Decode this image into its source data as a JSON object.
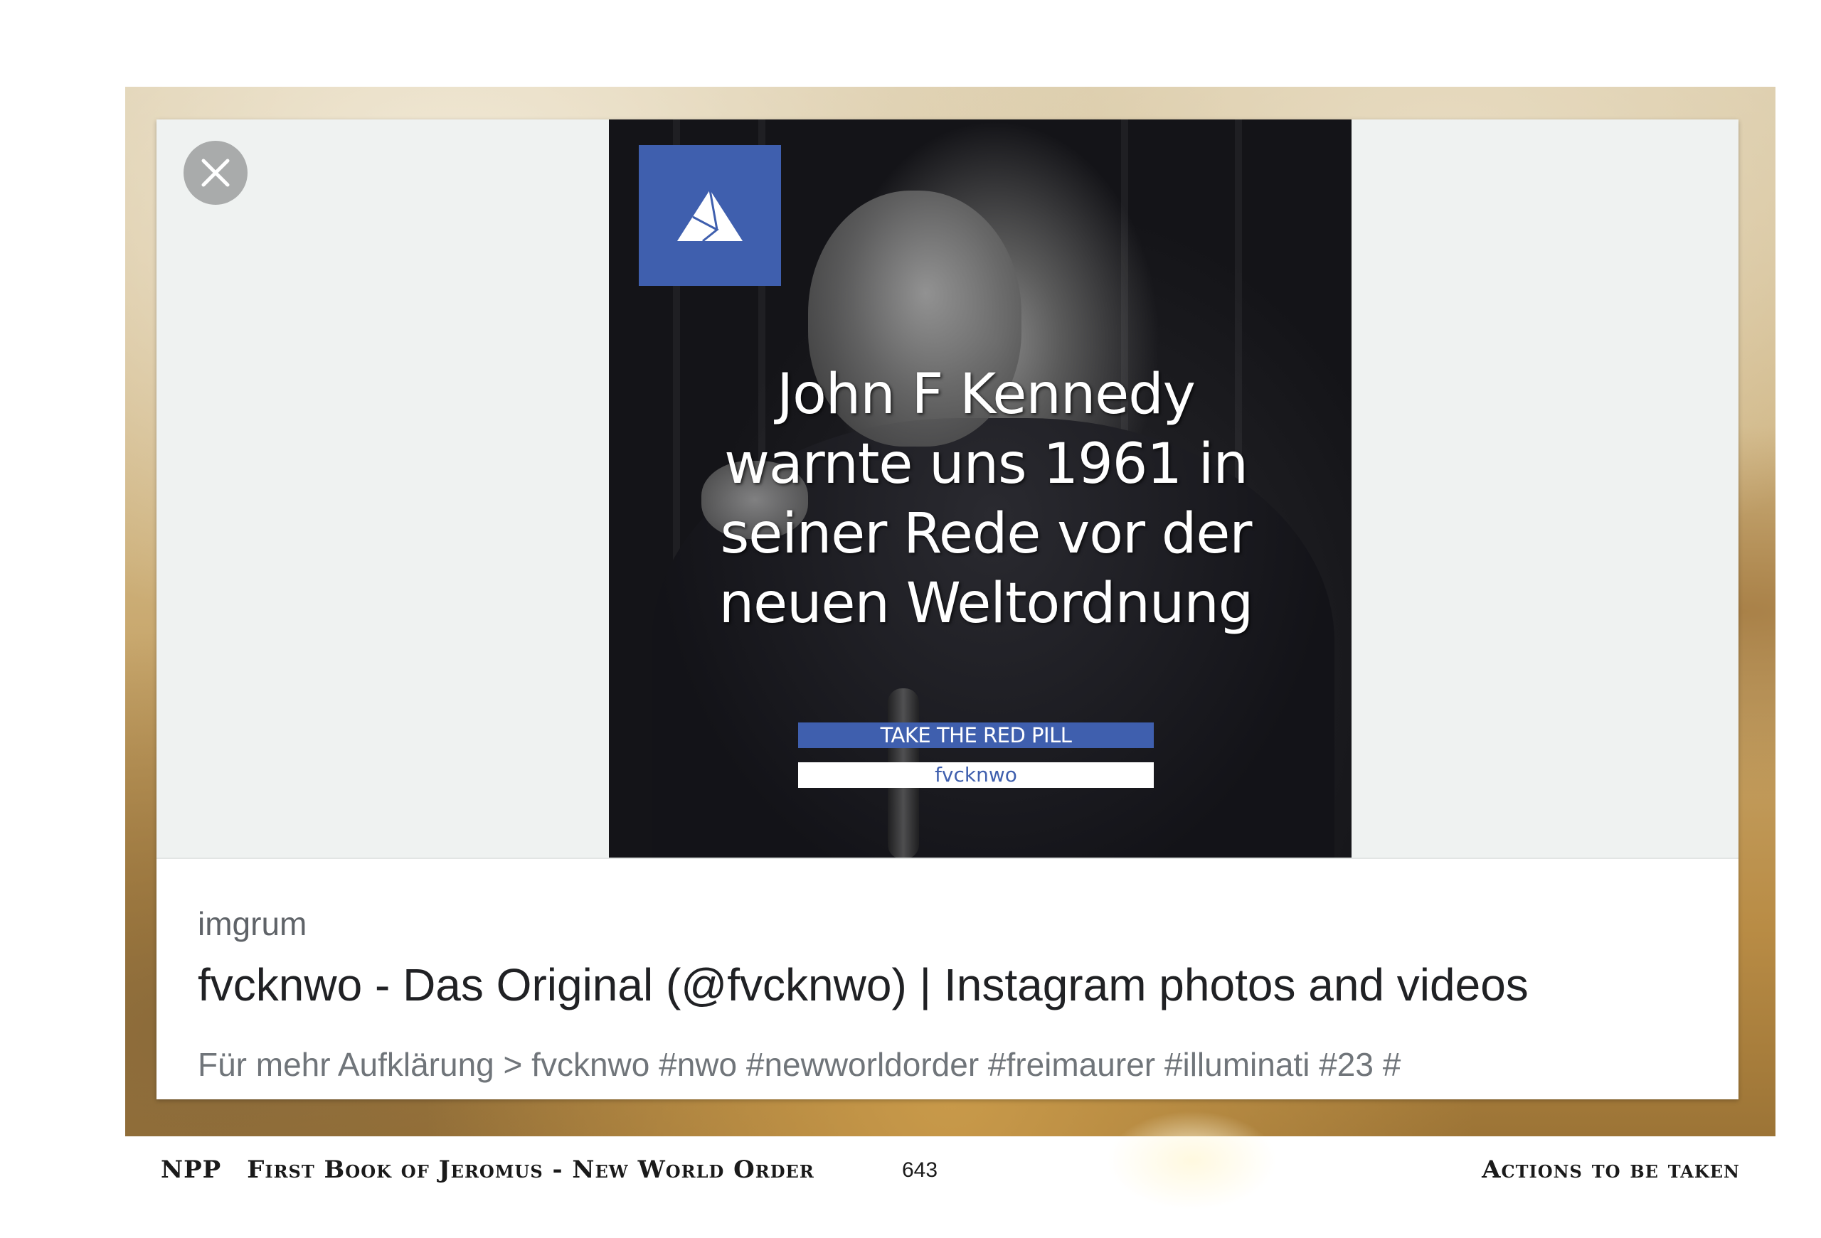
{
  "card": {
    "close_icon": "close-icon",
    "image": {
      "logo_icon": "triangle-logo-icon",
      "headline": [
        "John F Kennedy",
        "warnte uns 1961 in",
        "seiner Rede vor der",
        "neuen Weltordnung"
      ],
      "banner": "TAKE THE RED PILL",
      "handle": "fvcknwo"
    },
    "source": "imgrum",
    "title": "fvcknwo - Das Original (@fvcknwo) | Instagram photos and videos",
    "description": "Für mehr Aufklärung > fvcknwo #nwo #newworldorder #freimaurer #illuminati #23 #"
  },
  "footer": {
    "abbr": "NPP",
    "book": "First Book of Jeromus - New World Order",
    "page_number": "643",
    "section": "Actions to be taken"
  },
  "colors": {
    "accent_blue": "#3f5fae",
    "close_button": "#a9abab"
  }
}
